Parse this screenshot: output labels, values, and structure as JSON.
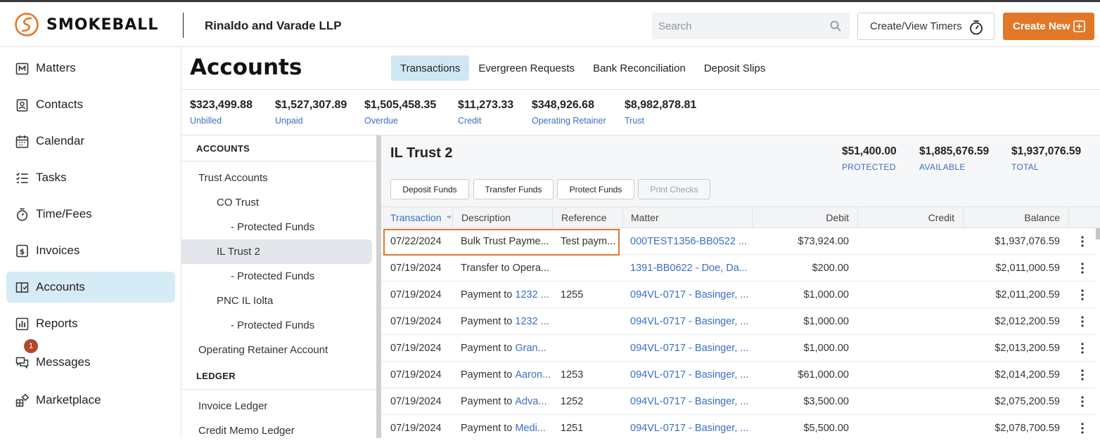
{
  "brand": {
    "name": "SMOKEBALL",
    "accent": "#e07828",
    "link": "#3a6fc4"
  },
  "header": {
    "firm": "Rinaldo and Varade LLP",
    "search_placeholder": "Search",
    "timers_label": "Create/View Timers",
    "create_label": "Create New"
  },
  "sidebar": {
    "items": [
      {
        "label": "Matters",
        "icon": "matters-icon"
      },
      {
        "label": "Contacts",
        "icon": "contacts-icon"
      },
      {
        "label": "Calendar",
        "icon": "calendar-icon"
      },
      {
        "label": "Tasks",
        "icon": "tasks-icon"
      },
      {
        "label": "Time/Fees",
        "icon": "stopwatch-icon"
      },
      {
        "label": "Invoices",
        "icon": "invoice-icon"
      },
      {
        "label": "Accounts",
        "icon": "accounts-icon",
        "active": true
      },
      {
        "label": "Reports",
        "icon": "reports-icon"
      },
      {
        "label": "Messages",
        "icon": "messages-icon",
        "badge": "1"
      },
      {
        "label": "Marketplace",
        "icon": "marketplace-icon"
      }
    ]
  },
  "page": {
    "title": "Accounts",
    "tabs": [
      "Transactions",
      "Evergreen Requests",
      "Bank Reconciliation",
      "Deposit Slips"
    ],
    "active_tab": "Transactions"
  },
  "stats": [
    {
      "value": "$323,499.88",
      "label": "Unbilled"
    },
    {
      "value": "$1,527,307.89",
      "label": "Unpaid"
    },
    {
      "value": "$1,505,458.35",
      "label": "Overdue"
    },
    {
      "value": "$11,273.33",
      "label": "Credit"
    },
    {
      "value": "$348,926.68",
      "label": "Operating Retainer"
    },
    {
      "value": "$8,982,878.81",
      "label": "Trust"
    }
  ],
  "tree": {
    "accounts_heading": "ACCOUNTS",
    "ledger_heading": "LEDGER",
    "items": [
      "Trust Accounts",
      "CO Trust",
      "- Protected Funds",
      "IL Trust 2",
      "- Protected Funds",
      "PNC IL Iolta",
      "- Protected Funds",
      "Operating Retainer Account"
    ],
    "ledger_items": [
      "Invoice Ledger",
      "Credit Memo Ledger"
    ],
    "selected": "IL Trust 2"
  },
  "account": {
    "title": "IL Trust 2",
    "balances": [
      {
        "value": "$51,400.00",
        "label": "PROTECTED"
      },
      {
        "value": "$1,885,676.59",
        "label": "AVAILABLE"
      },
      {
        "value": "$1,937,076.59",
        "label": "TOTAL"
      }
    ],
    "actions": [
      "Deposit Funds",
      "Transfer Funds",
      "Protect Funds",
      "Print Checks"
    ]
  },
  "table": {
    "columns": [
      "Transaction",
      "Description",
      "Reference",
      "Matter",
      "Debit",
      "Credit",
      "Balance"
    ],
    "rows": [
      {
        "date": "07/22/2024",
        "desc": "Bulk Trust Payme...",
        "desc_link": "",
        "ref": "Test paym...",
        "matter": "000TEST1356-BB0522 ...",
        "debit": "$73,924.00",
        "credit": "",
        "balance": "$1,937,076.59"
      },
      {
        "date": "07/19/2024",
        "desc": "Transfer to Opera...",
        "desc_link": "",
        "ref": "",
        "matter": "1391-BB0622 - Doe, Da...",
        "debit": "$200.00",
        "credit": "",
        "balance": "$2,011,000.59"
      },
      {
        "date": "07/19/2024",
        "desc": "Payment to ",
        "desc_link": "1232 ...",
        "ref": "1255",
        "matter": "094VL-0717 - Basinger, ...",
        "debit": "$1,000.00",
        "credit": "",
        "balance": "$2,011,200.59"
      },
      {
        "date": "07/19/2024",
        "desc": "Payment to ",
        "desc_link": "1232 ...",
        "ref": "",
        "matter": "094VL-0717 - Basinger, ...",
        "debit": "$1,000.00",
        "credit": "",
        "balance": "$2,012,200.59"
      },
      {
        "date": "07/19/2024",
        "desc": "Payment to ",
        "desc_link": "Gran...",
        "ref": "",
        "matter": "094VL-0717 - Basinger, ...",
        "debit": "$1,000.00",
        "credit": "",
        "balance": "$2,013,200.59"
      },
      {
        "date": "07/19/2024",
        "desc": "Payment to ",
        "desc_link": "Aaron...",
        "ref": "1253",
        "matter": "094VL-0717 - Basinger, ...",
        "debit": "$61,000.00",
        "credit": "",
        "balance": "$2,014,200.59"
      },
      {
        "date": "07/19/2024",
        "desc": "Payment to ",
        "desc_link": "Adva...",
        "ref": "1252",
        "matter": "094VL-0717 - Basinger, ...",
        "debit": "$3,500.00",
        "credit": "",
        "balance": "$2,075,200.59"
      },
      {
        "date": "07/19/2024",
        "desc": "Payment to ",
        "desc_link": "Medi...",
        "ref": "1251",
        "matter": "094VL-0717 - Basinger, ...",
        "debit": "$5,500.00",
        "credit": "",
        "balance": "$2,078,700.59"
      }
    ]
  }
}
